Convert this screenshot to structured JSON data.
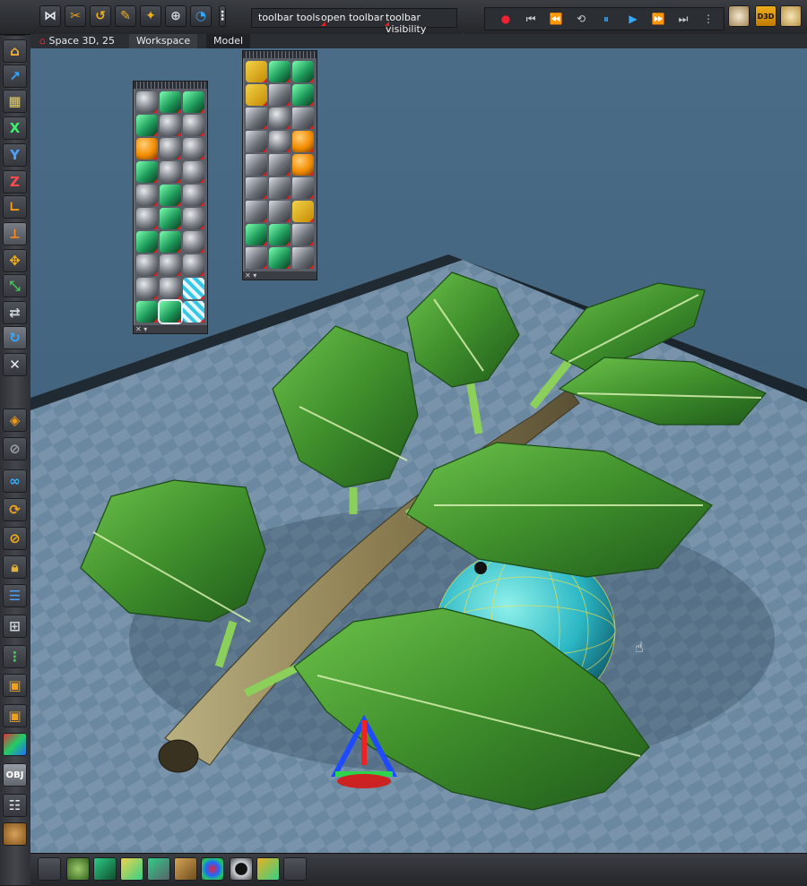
{
  "topbar": {
    "menu": [
      "toolbar tools",
      "open toolbar",
      "toolbar visibility"
    ],
    "play_controls": [
      "record",
      "go-start",
      "step-back",
      "loop",
      "pause",
      "play",
      "step-forward",
      "go-end"
    ],
    "right_icons": [
      "plate-icon",
      "d3d-icon",
      "globe-icon"
    ],
    "d3d_label": "D3D"
  },
  "tabs": {
    "scene": "Space 3D, 25",
    "workspace": "Workspace",
    "model": "Model"
  },
  "left_toolbar": {
    "axis_labels": [
      "X",
      "Y",
      "Z"
    ],
    "obj_label": "OBJ"
  },
  "panel_left": {
    "rows": 10,
    "cols": 3
  },
  "panel_right": {
    "rows": 9,
    "cols": 3
  },
  "colors": {
    "accent_green": "#2fd08a",
    "viewport_blue": "#436580",
    "leaf_green": "#3f8f2c",
    "sphere_cyan": "#2bb7c4"
  }
}
